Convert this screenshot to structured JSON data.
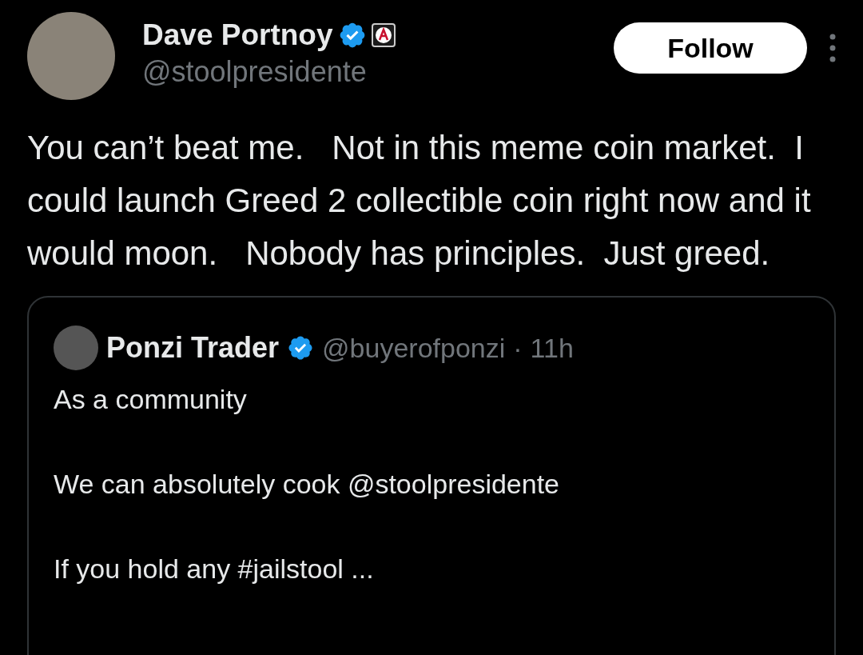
{
  "author": {
    "name": "Dave Portnoy",
    "handle": "@stoolpresidente",
    "verified": true,
    "affiliate_badge": true
  },
  "follow_button": "Follow",
  "text": "You can’t beat me.   Not in this meme coin market.  I could launch Greed 2 collectible coin right now and it would moon.   Nobody has principles.  Just greed.",
  "quoted": {
    "author": {
      "name": "Ponzi Trader",
      "handle": "@buyerofponzi",
      "verified": true
    },
    "separator": "·",
    "time": "11h",
    "paragraphs": [
      "As a community",
      "We can absolutely cook @stoolpresidente",
      "If you hold any #jailstool ..."
    ]
  }
}
